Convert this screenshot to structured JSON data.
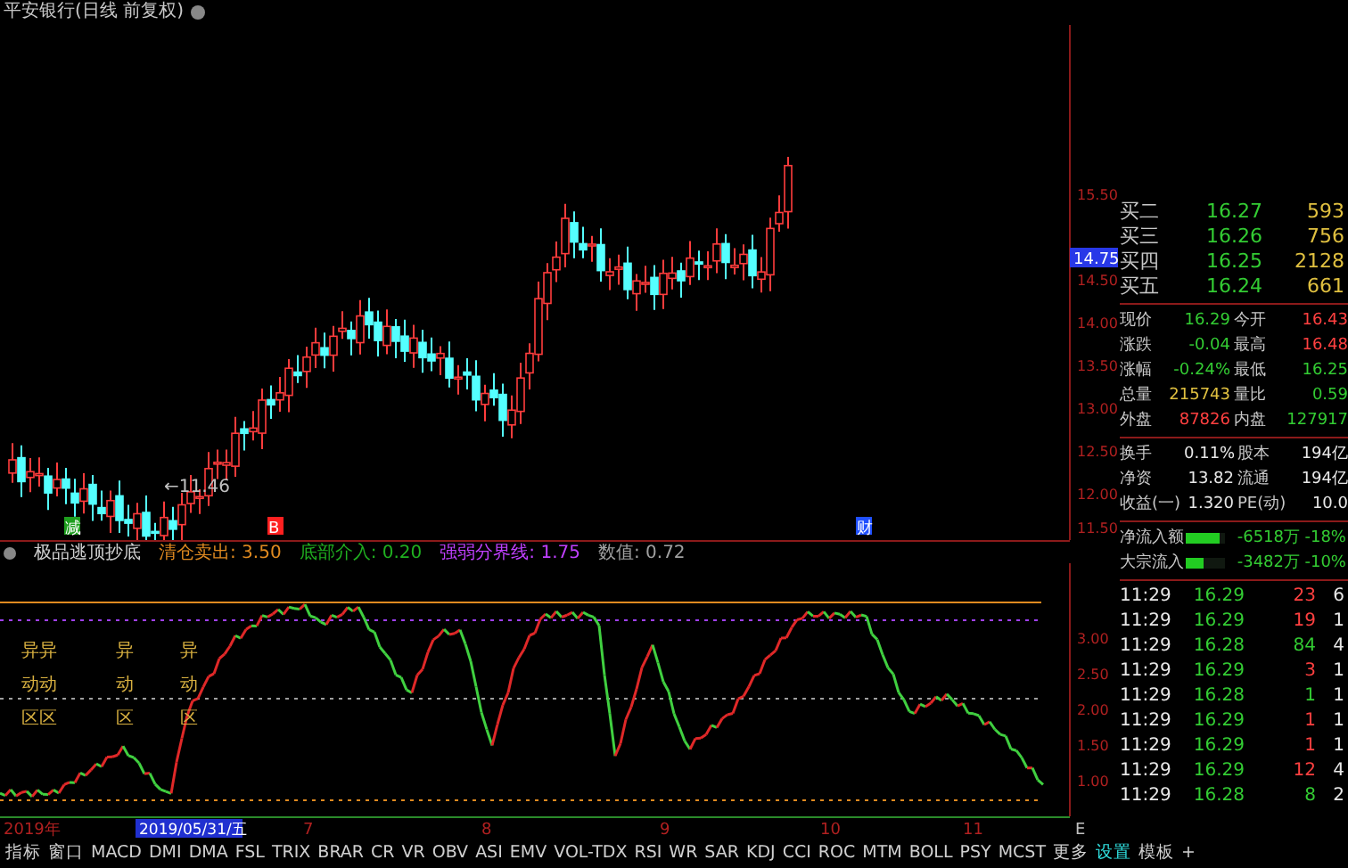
{
  "title": {
    "text": "平安银行(日线 前复权)"
  },
  "price_axis": [
    "15.50",
    "14.50",
    "14.00",
    "13.50",
    "13.00",
    "12.50",
    "12.00",
    "11.50"
  ],
  "price_marker": "14.75",
  "low_label": "←11.46",
  "signals": [
    {
      "text": "减",
      "color": "#1e9e1e"
    },
    {
      "text": "B",
      "color": "#ff2020"
    },
    {
      "text": "财",
      "color": "#2050ff"
    }
  ],
  "indicator": {
    "name": "极品逃顶抄底",
    "params": [
      {
        "label": "清仓卖出:",
        "value": "3.50",
        "color": "#e08a20"
      },
      {
        "label": "底部介入:",
        "value": "0.20",
        "color": "#20b020"
      },
      {
        "label": "强弱分界线:",
        "value": "1.75",
        "color": "#c040ff"
      },
      {
        "label": "数值:",
        "value": "0.72",
        "color": "#a0a0a0"
      }
    ],
    "axis": [
      "3.00",
      "2.50",
      "2.00",
      "1.50",
      "1.00"
    ],
    "zones": [
      "异动区",
      "异动区",
      "异动区",
      "异动区"
    ]
  },
  "date_axis": {
    "start": "2019年",
    "cursor": "2019/05/31/五",
    "months": [
      "7",
      "8",
      "9",
      "10",
      "11"
    ],
    "end": "E"
  },
  "tabs": [
    {
      "label": "指标",
      "selected": false
    },
    {
      "label": "窗口",
      "selected": false
    },
    {
      "label": "MACD",
      "selected": false
    },
    {
      "label": "DMI",
      "selected": false
    },
    {
      "label": "DMA",
      "selected": false
    },
    {
      "label": "FSL",
      "selected": false
    },
    {
      "label": "TRIX",
      "selected": false
    },
    {
      "label": "BRAR",
      "selected": false
    },
    {
      "label": "CR",
      "selected": false
    },
    {
      "label": "VR",
      "selected": false
    },
    {
      "label": "OBV",
      "selected": false
    },
    {
      "label": "ASI",
      "selected": false
    },
    {
      "label": "EMV",
      "selected": false
    },
    {
      "label": "VOL-TDX",
      "selected": false
    },
    {
      "label": "RSI",
      "selected": false
    },
    {
      "label": "WR",
      "selected": false
    },
    {
      "label": "SAR",
      "selected": false
    },
    {
      "label": "KDJ",
      "selected": false
    },
    {
      "label": "CCI",
      "selected": false
    },
    {
      "label": "ROC",
      "selected": false
    },
    {
      "label": "MTM",
      "selected": false
    },
    {
      "label": "BOLL",
      "selected": false
    },
    {
      "label": "PSY",
      "selected": false
    },
    {
      "label": "MCST",
      "selected": false
    },
    {
      "label": "更多",
      "selected": false
    },
    {
      "label": "设置",
      "selected": true
    }
  ],
  "right_tabs": [
    "模板",
    "+"
  ],
  "order_book": [
    {
      "label": "买二",
      "price": "16.27",
      "volume": "593"
    },
    {
      "label": "买三",
      "price": "16.26",
      "volume": "756"
    },
    {
      "label": "买四",
      "price": "16.25",
      "volume": "2128"
    },
    {
      "label": "买五",
      "price": "16.24",
      "volume": "661"
    }
  ],
  "quote": [
    [
      {
        "text": "现价",
        "color": "#c8c8c8"
      },
      {
        "text": "16.29",
        "color": "#33cc33"
      },
      {
        "text": "今开",
        "color": "#c8c8c8"
      },
      {
        "text": "16.43",
        "color": "#ff4040"
      }
    ],
    [
      {
        "text": "涨跌",
        "color": "#c8c8c8"
      },
      {
        "text": "-0.04",
        "color": "#33cc33"
      },
      {
        "text": "最高",
        "color": "#c8c8c8"
      },
      {
        "text": "16.48",
        "color": "#ff4040"
      }
    ],
    [
      {
        "text": "涨幅",
        "color": "#c8c8c8"
      },
      {
        "text": "-0.24%",
        "color": "#33cc33"
      },
      {
        "text": "最低",
        "color": "#c8c8c8"
      },
      {
        "text": "16.25",
        "color": "#33cc33"
      }
    ],
    [
      {
        "text": "总量",
        "color": "#c8c8c8"
      },
      {
        "text": "215743",
        "color": "#e0c040"
      },
      {
        "text": "量比",
        "color": "#c8c8c8"
      },
      {
        "text": "0.59",
        "color": "#33cc33"
      }
    ],
    [
      {
        "text": "外盘",
        "color": "#c8c8c8"
      },
      {
        "text": "87826",
        "color": "#ff4040"
      },
      {
        "text": "内盘",
        "color": "#c8c8c8"
      },
      {
        "text": "127917",
        "color": "#33cc33"
      }
    ]
  ],
  "fundamentals": [
    {
      "l1": "换手",
      "v1": "0.11%",
      "l2": "股本",
      "v2": "194亿"
    },
    {
      "l1": "净资",
      "v1": "13.82",
      "l2": "流通",
      "v2": "194亿"
    },
    {
      "l1": "收益(一)",
      "v1": "1.320",
      "l2": "PE(动)",
      "v2": "10.0"
    }
  ],
  "flows": [
    {
      "label": "净流入额",
      "level": 0.85,
      "amount": "-6518万",
      "pct": "-18%"
    },
    {
      "label": "大宗流入",
      "level": 0.45,
      "amount": "-3482万",
      "pct": "-10%"
    }
  ],
  "ticks": [
    {
      "time": "11:29",
      "price": "16.29",
      "volume": "23",
      "color": "#ff4040",
      "column_4": "6"
    },
    {
      "time": "11:29",
      "price": "16.29",
      "volume": "19",
      "color": "#ff4040",
      "column_4": "1"
    },
    {
      "time": "11:29",
      "price": "16.28",
      "volume": "84",
      "color": "#33cc33",
      "column_4": "4"
    },
    {
      "time": "11:29",
      "price": "16.29",
      "volume": "3",
      "color": "#ff4040",
      "column_4": "1"
    },
    {
      "time": "11:29",
      "price": "16.28",
      "volume": "1",
      "color": "#33cc33",
      "column_4": "1"
    },
    {
      "time": "11:29",
      "price": "16.29",
      "volume": "1",
      "color": "#ff4040",
      "column_4": "1"
    },
    {
      "time": "11:29",
      "price": "16.29",
      "volume": "1",
      "color": "#ff4040",
      "column_4": "1"
    },
    {
      "time": "11:29",
      "price": "16.29",
      "volume": "12",
      "color": "#ff4040",
      "column_4": "4"
    },
    {
      "time": "11:29",
      "price": "16.28",
      "volume": "8",
      "color": "#33cc33",
      "column_4": "2"
    }
  ]
}
